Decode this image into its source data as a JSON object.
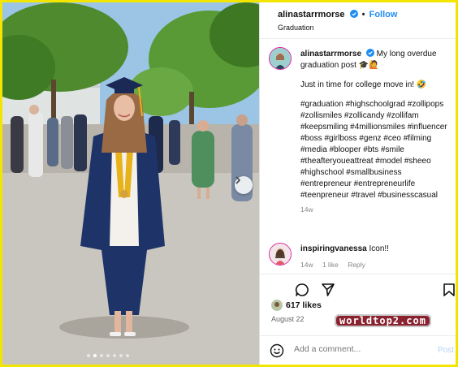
{
  "post": {
    "username": "alinastarrmorse",
    "follow_label": "Follow",
    "location": "Graduation",
    "caption_text": "My long overdue graduation post 🎓🙋",
    "caption_line2": "Just in time for college move in! 🤣",
    "hashtags": "#graduation #highschoolgrad #zollipops #zollismiles #zollicandy #zollifam #keepsmiling #4millionsmiles #influencer #boss #girlboss #genz #ceo #filming #media #blooper #bts #smile #theafteryoueattreat #model #sheeo #highschool #smallbusiness #entrepreneur #entrepreneurlife #teenpreneur #travel #businesscasual",
    "caption_time": "14w"
  },
  "comment": {
    "username": "inspiringvanessa",
    "text": "Icon!!",
    "time": "14w",
    "likes": "1 like",
    "reply_label": "Reply"
  },
  "likes_label": "617 likes",
  "date": "August 22",
  "watermark": "worldtop2.com",
  "add_comment": {
    "placeholder": "Add a comment...",
    "post_label": "Post"
  },
  "carousel": {
    "dot_count": 7,
    "active_index": 1
  },
  "icons": {
    "verified": "verified-badge-icon",
    "comment": "comment-icon",
    "share": "send-icon",
    "save": "bookmark-icon",
    "emoji": "emoji-icon",
    "next": "chevron-right-icon"
  },
  "colors": {
    "accent": "#1d8cf0",
    "frame": "#f2e600",
    "gown": "#1e3468",
    "stole": "#e8b21b"
  }
}
